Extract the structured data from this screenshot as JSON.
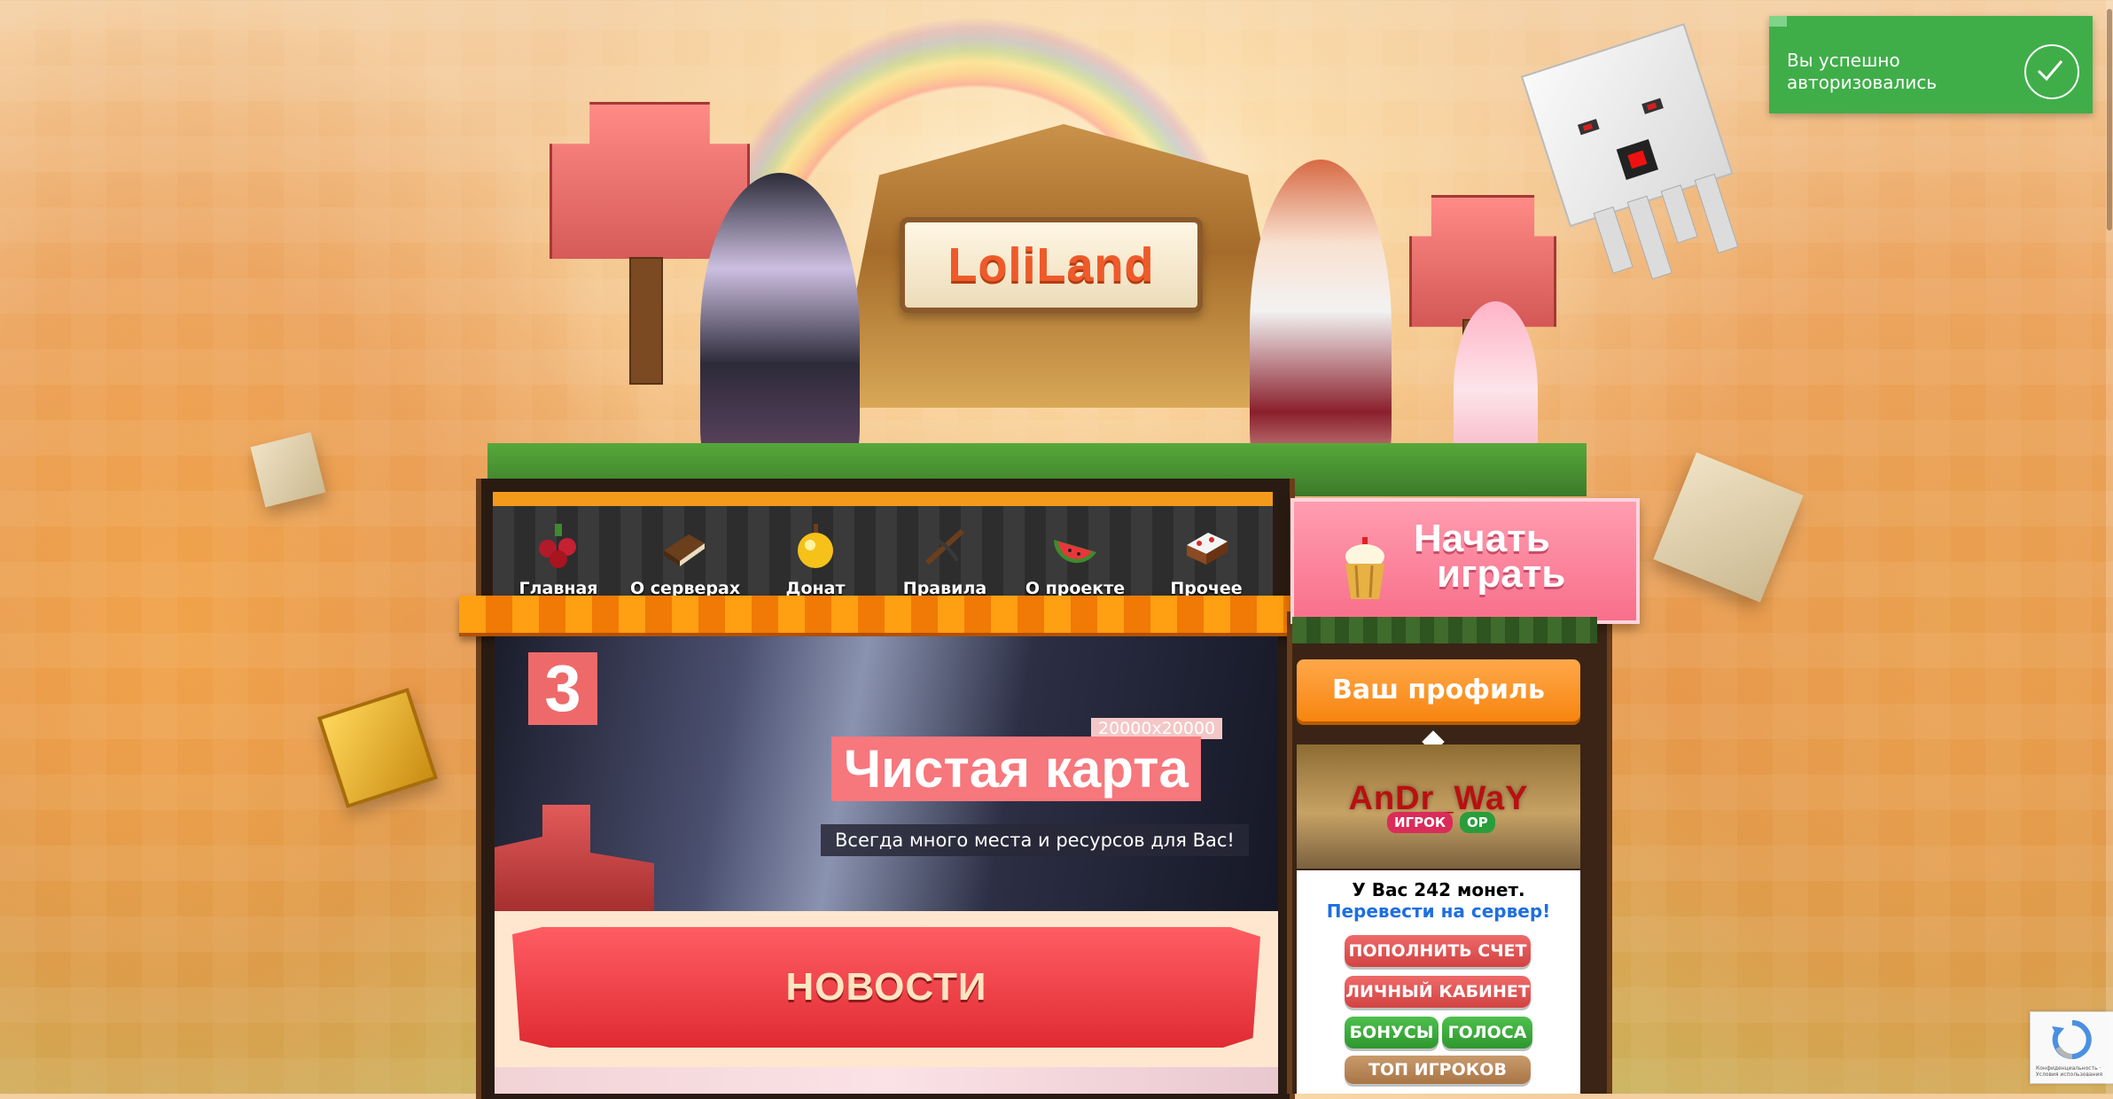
{
  "brand": {
    "logo_text": "LoliLand"
  },
  "nav": {
    "items": [
      {
        "label": "Главная",
        "icon": "berries-icon"
      },
      {
        "label": "О серверах",
        "icon": "book-icon"
      },
      {
        "label": "Донат",
        "icon": "golden-apple-icon"
      },
      {
        "label": "Правила",
        "icon": "crossbow-icon"
      },
      {
        "label": "О проекте",
        "icon": "watermelon-icon"
      },
      {
        "label": "Прочее",
        "icon": "cake-icon"
      }
    ]
  },
  "play_button": {
    "line1": "Начать",
    "line2": "играть"
  },
  "banner": {
    "number": "3",
    "size_tag": "20000x20000",
    "title": "Чистая карта",
    "subtitle": "Всегда много места и ресурсов для Вас!"
  },
  "news": {
    "title": "НОВОСТИ"
  },
  "profile": {
    "button_label": "Ваш профиль",
    "nickname": "AnDr_WaY",
    "role_badge": "ИГРОК",
    "op_badge": "OP",
    "coins_text": "У Вас 242 монет.",
    "transfer_link": "Перевести на сервер!",
    "buttons": {
      "topup": "ПОПОЛНИТЬ СЧЕТ",
      "cabinet": "ЛИЧНЫЙ КАБИНЕТ",
      "bonuses": "БОНУСЫ",
      "votes": "ГОЛОСА",
      "top_players": "ТОП ИГРОКОВ"
    }
  },
  "notification": {
    "text": "Вы успешно авторизовались",
    "color": "#3fae49"
  },
  "recaptcha": {
    "text": "Конфиденциальность · Условия использования"
  },
  "colors": {
    "accent_orange": "#f7850f",
    "accent_pink": "#f86f8b",
    "news_red": "#e02b33",
    "link_blue": "#1d6fe0"
  }
}
